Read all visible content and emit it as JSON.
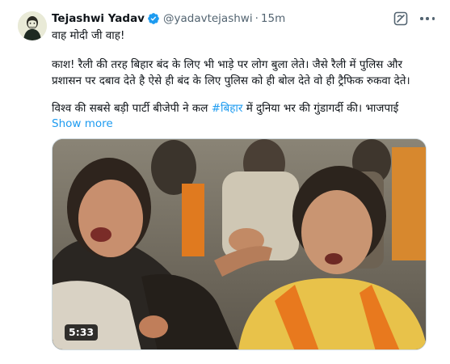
{
  "author": {
    "name": "Tejashwi Yadav",
    "handle": "@yadavtejashwi",
    "separator": "·",
    "time": "15m"
  },
  "tweet": {
    "line1": "वाह मोदी जी वाह!",
    "line2": "काश! रैली की तरह बिहार बंद के लिए भी भाड़े पर लोग बुला लेते। जैसे रैली में पुलिस और",
    "line3": "प्रशासन पर दबाव देते है ऐसे ही बंद के लिए पुलिस को ही बोल देते वो ही ट्रैफिक रुकवा देते।",
    "line4_before": "विश्व की सबसे बड़ी पार्टी बीजेपी ने कल ",
    "hashtag": "#बिहार",
    "line4_after": " में दुनिया भर की गुंडागर्दी की। भाजपाई",
    "show_more": "Show more"
  },
  "media": {
    "type": "video",
    "duration": "5:33"
  },
  "icons": {
    "verified": "verified-badge-icon",
    "grok": "grok-icon",
    "more": "more-options-icon"
  },
  "colors": {
    "link": "#1d9bf0",
    "secondary_text": "#536471",
    "saffron": "#e8791e"
  }
}
